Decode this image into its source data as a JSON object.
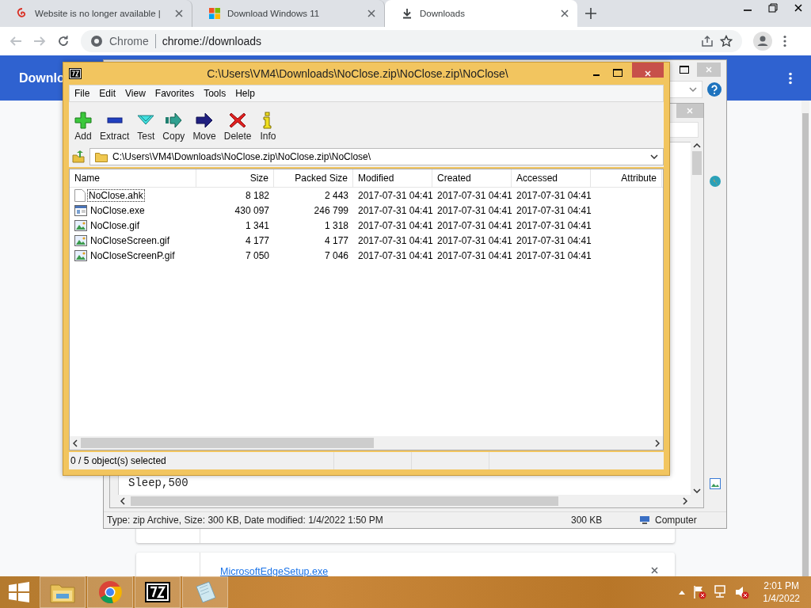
{
  "browser": {
    "tabs": [
      {
        "title": "Website is no longer available |",
        "kind": "swirl",
        "selected": false
      },
      {
        "title": "Download Windows 11",
        "kind": "windows",
        "selected": false
      },
      {
        "title": "Downloads",
        "kind": "download",
        "selected": true
      }
    ],
    "omnibox": {
      "site": "Chrome",
      "url": "chrome://downloads"
    },
    "header_title": "Downlo",
    "downloads": [
      {
        "name": "MicrosoftEdgeSetup.exe"
      }
    ]
  },
  "explorer_window": {
    "notepad_text": "Sleep,500",
    "status": "Type: zip Archive, Size: 300 KB, Date modified: 1/4/2022 1:50 PM",
    "size": "300 KB",
    "location": "Computer"
  },
  "archive_window": {
    "title": "C:\\Users\\VM4\\Downloads\\NoClose.zip\\NoClose.zip\\NoClose\\",
    "menu": [
      "File",
      "Edit",
      "View",
      "Favorites",
      "Tools",
      "Help"
    ],
    "toolbar": [
      {
        "label": "Add",
        "kind": "add"
      },
      {
        "label": "Extract",
        "kind": "extract"
      },
      {
        "label": "Test",
        "kind": "test"
      },
      {
        "label": "Copy",
        "kind": "copy"
      },
      {
        "label": "Move",
        "kind": "move"
      },
      {
        "label": "Delete",
        "kind": "delete"
      },
      {
        "label": "Info",
        "kind": "info"
      }
    ],
    "path": "C:\\Users\\VM4\\Downloads\\NoClose.zip\\NoClose.zip\\NoClose\\",
    "columns": [
      "Name",
      "Size",
      "Packed Size",
      "Modified",
      "Created",
      "Accessed",
      "Attribute"
    ],
    "rows": [
      {
        "kind": "text",
        "focused": true,
        "cells": [
          "NoClose.ahk",
          "8 182",
          "2 443",
          "2017-07-31 04:41",
          "2017-07-31 04:41",
          "2017-07-31 04:41"
        ]
      },
      {
        "kind": "exe",
        "focused": false,
        "cells": [
          "NoClose.exe",
          "430 097",
          "246 799",
          "2017-07-31 04:41",
          "2017-07-31 04:41",
          "2017-07-31 04:41"
        ]
      },
      {
        "kind": "image",
        "focused": false,
        "cells": [
          "NoClose.gif",
          "1 341",
          "1 318",
          "2017-07-31 04:41",
          "2017-07-31 04:41",
          "2017-07-31 04:41"
        ]
      },
      {
        "kind": "image",
        "focused": false,
        "cells": [
          "NoCloseScreen.gif",
          "4 177",
          "4 177",
          "2017-07-31 04:41",
          "2017-07-31 04:41",
          "2017-07-31 04:41"
        ]
      },
      {
        "kind": "image",
        "focused": false,
        "cells": [
          "NoCloseScreenP.gif",
          "7 050",
          "7 046",
          "2017-07-31 04:41",
          "2017-07-31 04:41",
          "2017-07-31 04:41"
        ]
      }
    ],
    "status": "0 / 5 object(s) selected"
  },
  "taskbar": {
    "apps": [
      {
        "kind": "explorer"
      },
      {
        "kind": "chrome"
      },
      {
        "kind": "sevenzip"
      },
      {
        "kind": "notepad"
      }
    ],
    "time": "2:01 PM",
    "date": "1/4/2022"
  }
}
